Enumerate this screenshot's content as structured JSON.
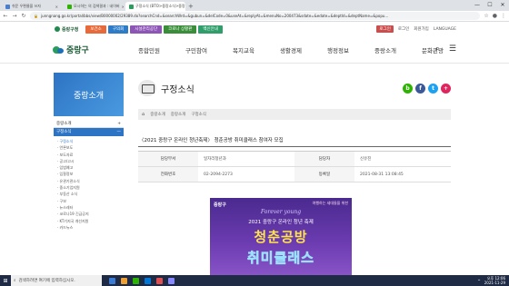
{
  "browser": {
    "tabs": [
      {
        "title": "쉬운 우편물을 쓰자",
        "fav_color": "#4a7ecf"
      },
      {
        "title": "모시하는 의 검색결과 : 네이버",
        "fav_color": "#2db400"
      },
      {
        "title": "구정소식 (BTO>중랑소식>중랑",
        "fav_color": "#2a9d5c",
        "active": true
      }
    ],
    "new_tab": "+",
    "url": "junngnang.go.kr/portal/bbs/view/B0000002/29389.do?searchCnd=&searchWrd=&gubun=&delCode=0&useAt=&replyAt=&menuNo=200473&sdate=&edate=&deptId=&deptName=&popu...",
    "controls": {
      "min": "—",
      "max": "☐",
      "close": "✕"
    }
  },
  "utility": {
    "logo": "중랑구청",
    "quick": [
      {
        "label": "보건소",
        "color": "#e86a3a"
      },
      {
        "label": "구의회",
        "color": "#2e7cc7"
      },
      {
        "label": "시설관리공단",
        "color": "#8d55b5"
      },
      {
        "label": "코로나 상황판",
        "color": "#3a8e3a"
      },
      {
        "label": "백신안내",
        "color": "#2f9e6b"
      }
    ],
    "right": {
      "mini": "로그인",
      "login": "로그인",
      "join": "회원가입",
      "lang": "LANGUAGE"
    }
  },
  "gnb": {
    "logo": "중랑구",
    "items": [
      "종합민원",
      "구민참여",
      "복지교육",
      "생활경제",
      "행정정보",
      "중랑소개",
      "문화관광"
    ]
  },
  "sidebar": {
    "hero": "중랑소개",
    "rows": [
      {
        "label": "중랑소개",
        "sign": "+"
      },
      {
        "label": "구정소식",
        "sign": "—",
        "active": true
      }
    ],
    "sub": [
      "구정소식",
      "언론보도",
      "보도자료",
      "공고/고시",
      "입법예고",
      "입찰정보",
      "유관기관소식",
      "중소기업지원",
      "부동산 소식",
      "구보",
      "뉴스레터",
      "코로나19 긴급공지",
      "KT기지국 개선지원",
      "카드뉴스"
    ],
    "sub_active": 0
  },
  "main": {
    "page_title": "구정소식",
    "sns": [
      {
        "label": "b",
        "color": "#2db400"
      },
      {
        "label": "f",
        "color": "#3b5998"
      },
      {
        "label": "t",
        "color": "#1da1f2"
      },
      {
        "label": "+",
        "color": "#e0245e"
      }
    ],
    "breadcrumb": [
      "중랑소개",
      "중랑소개",
      "구정소식"
    ],
    "post_title": "〈2021 중랑구 온라인 청년축제〉 청춘공방 취미클래스 참여자 모집",
    "meta": [
      {
        "k1": "담당부서",
        "v1": "일자리청년과",
        "k2": "담당자",
        "v2": "신유진"
      },
      {
        "k1": "전화번호",
        "v1": "02-2094-2273",
        "k2": "등록일",
        "v2": "2021-08-31 13:08:45"
      }
    ],
    "poster": {
      "logo": "중랑구",
      "tag": "여행하는 세대들을 위한",
      "script": "Forever young",
      "year_line": "2021 중랑구 온라인 청년 축제",
      "big1": "청춘공방",
      "big2": "취미클래스"
    }
  },
  "taskbar": {
    "search_placeholder": "검색하려면 여기에 입력하십시오.",
    "time": "오후 12:06",
    "date": "2021-11-29",
    "apps": [
      "#3a7bd5",
      "#f0a030",
      "#2db400",
      "#0078d7",
      "#e05050",
      "#8888ff"
    ]
  }
}
